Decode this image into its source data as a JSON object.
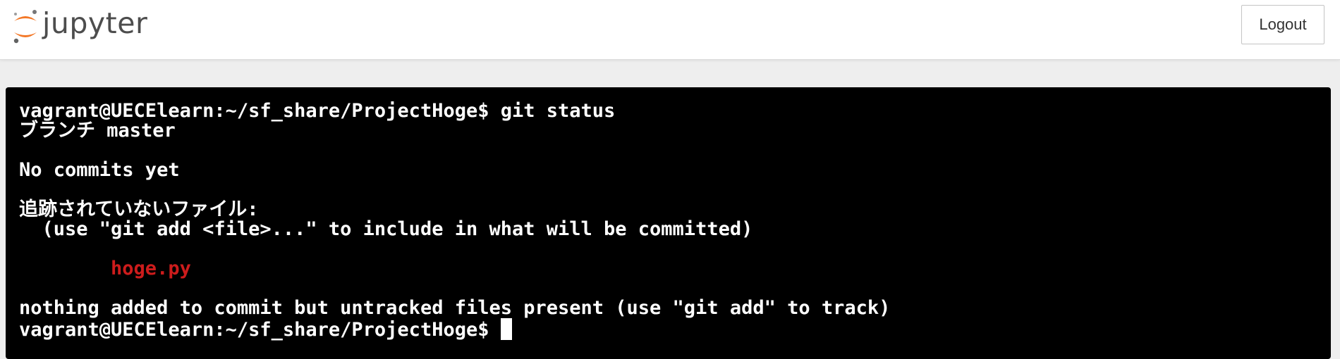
{
  "header": {
    "logo_text": "jupyter",
    "logout_label": "Logout"
  },
  "terminal": {
    "lines": [
      "vagrant@UECElearn:~/sf_share/ProjectHoge$ git status",
      "ブランチ master",
      "",
      "No commits yet",
      "",
      "追跡されていないファイル:",
      "  (use \"git add <file>...\" to include in what will be committed)",
      "",
      "        hoge.py",
      "",
      "nothing added to commit but untracked files present (use \"git add\" to track)",
      "vagrant@UECElearn:~/sf_share/ProjectHoge$ "
    ],
    "untracked_file_color": "#cd1c1c"
  },
  "colors": {
    "jupyter_orange": "#f37726",
    "logo_gray": "#4d4d4d"
  }
}
